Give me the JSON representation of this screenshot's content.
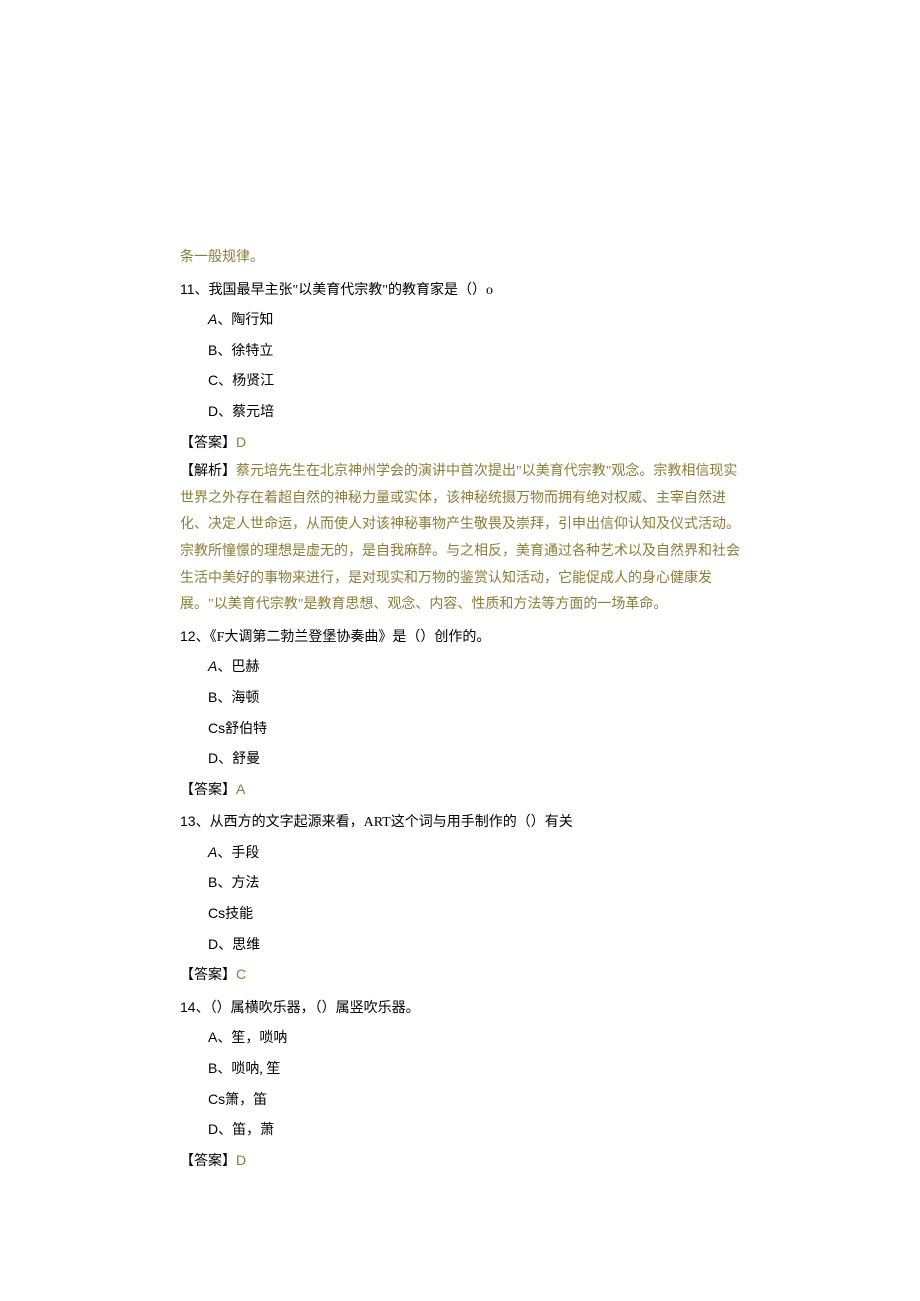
{
  "intro_fragment": "条一般规律。",
  "questions": [
    {
      "num": "11、",
      "text": "我国最早主张\"以美育代宗教\"的教育家是（）o",
      "options": [
        {
          "letter": "A",
          "sep": "、",
          "text": "陶行知",
          "italic": true
        },
        {
          "letter": "B",
          "sep": "、",
          "text": "徐特立",
          "italic": false
        },
        {
          "letter": "C",
          "sep": "、",
          "text": "杨贤江",
          "italic": false
        },
        {
          "letter": "D",
          "sep": "、",
          "text": "蔡元培",
          "italic": false
        }
      ],
      "answer_label": "【答案】",
      "answer_value": "D",
      "explanation_label": "【解析】",
      "explanation_text": "蔡元培先生在北京神州学会的演讲中首次提出\"以美育代宗教\"观念。宗教相信现实世界之外存在着超自然的神秘力量或实体，该神秘统摄万物而拥有绝对权威、主宰自然进化、决定人世命运，从而使人对该神秘事物产生敬畏及崇拜，引申出信仰认知及仪式活动。宗教所憧憬的理想是虚无的，是自我麻醉。与之相反，美育通过各种艺术以及自然界和社会生活中美好的事物来进行，是对现实和万物的鉴赏认知活动，它能促成人的身心健康发展。\"以美育代宗教\"是教育思想、观念、内容、性质和方法等方面的一场革命。"
    },
    {
      "num": "12、",
      "text": "《F大调第二勃兰登堡协奏曲》是（）创作的。",
      "options": [
        {
          "letter": "A",
          "sep": "、",
          "text": "巴赫",
          "italic": true
        },
        {
          "letter": "B",
          "sep": "、",
          "text": "海顿",
          "italic": false
        },
        {
          "letter": "Cs",
          "sep": "",
          "text": "舒伯特",
          "italic": false
        },
        {
          "letter": "D",
          "sep": "、",
          "text": "舒曼",
          "italic": false
        }
      ],
      "answer_label": "【答案】",
      "answer_value": "A"
    },
    {
      "num": "13、",
      "text": "从西方的文字起源来看，ART这个词与用手制作的（）有关",
      "options": [
        {
          "letter": "A",
          "sep": "、",
          "text": "手段",
          "italic": true
        },
        {
          "letter": "B",
          "sep": "、",
          "text": "方法",
          "italic": false
        },
        {
          "letter": "Cs",
          "sep": "",
          "text": "技能",
          "italic": false
        },
        {
          "letter": "D",
          "sep": "、",
          "text": "思维",
          "italic": false
        }
      ],
      "answer_label": "【答案】",
      "answer_value": "C"
    },
    {
      "num": "14、",
      "text": "（）属横吹乐器，（）属竖吹乐器。",
      "options": [
        {
          "letter": "A",
          "sep": "、",
          "text": "笙，唢呐",
          "italic": false
        },
        {
          "letter": "B",
          "sep": "、",
          "text": "唢呐, 笙",
          "italic": false
        },
        {
          "letter": "Cs",
          "sep": "",
          "text": "箫，笛",
          "italic": false
        },
        {
          "letter": "D",
          "sep": "、",
          "text": "笛，萧",
          "italic": false
        }
      ],
      "answer_label": "【答案】",
      "answer_value": "D"
    }
  ]
}
